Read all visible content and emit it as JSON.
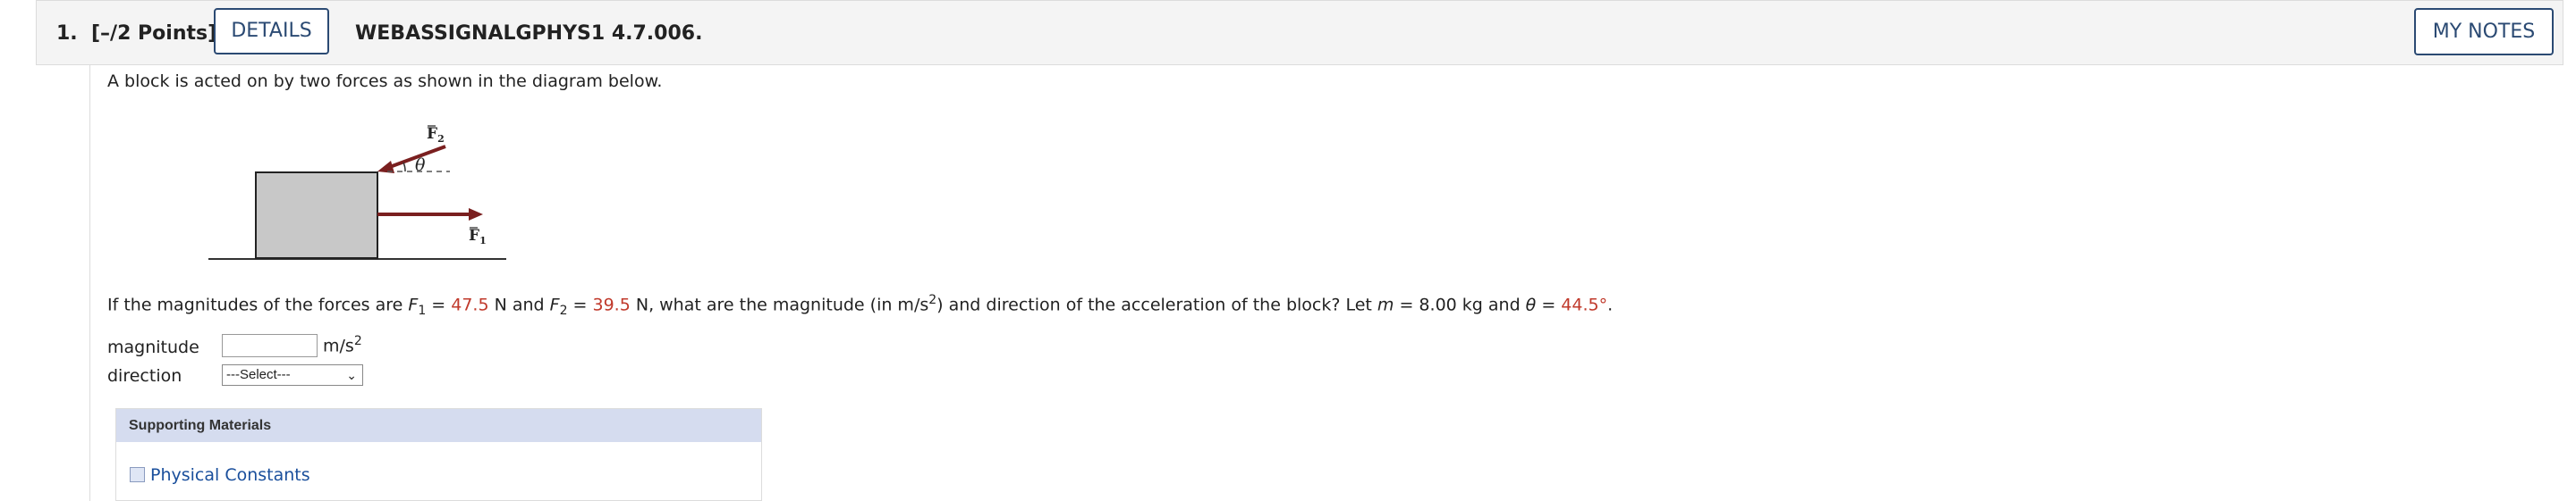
{
  "header": {
    "question_number": "1.",
    "points": "[–/2 Points]",
    "details_label": "DETAILS",
    "question_code": "WEBASSIGNALGPHYS1 4.7.006.",
    "my_notes_label": "MY NOTES"
  },
  "problem": {
    "intro": "A block is acted on by two forces as shown in the diagram below.",
    "diagram": {
      "f2_label": "F",
      "f2_sub": "2",
      "f1_label": "F",
      "f1_sub": "1",
      "theta_label": "θ"
    },
    "q_part1": "If the magnitudes of the forces are ",
    "F1_sym": "F",
    "F1_sub": "1",
    "eq": " = ",
    "F1_val": "47.5",
    "F1_unit": " N and ",
    "F2_sym": "F",
    "F2_sub": "2",
    "F2_val": "39.5",
    "q_part2": " N, what are the magnitude (in m/s",
    "sup2": "2",
    "q_part3": ") and direction of the acceleration of the block? Let ",
    "m_sym": "m",
    "m_eq": " = 8.00 kg and ",
    "theta_sym": "θ",
    "theta_eq": " = ",
    "theta_val": "44.5°",
    "period": "."
  },
  "answers": {
    "magnitude_label": "magnitude",
    "magnitude_unit": "m/s",
    "magnitude_unit_sup": "2",
    "magnitude_value": "",
    "direction_label": "direction",
    "direction_selected": "---Select---"
  },
  "supporting": {
    "title": "Supporting Materials",
    "items": [
      {
        "label": "Physical Constants",
        "checked": false
      }
    ]
  }
}
